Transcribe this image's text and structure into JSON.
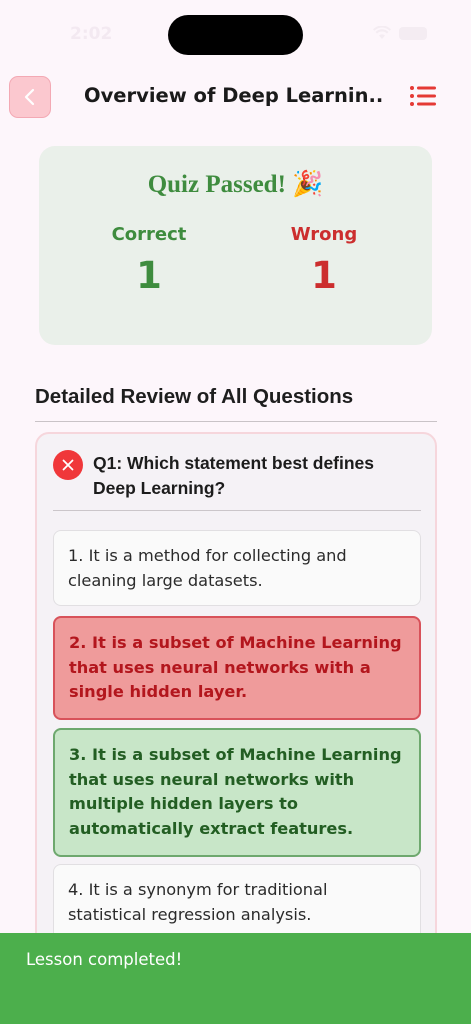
{
  "status_bar": {
    "time": "2:02"
  },
  "header": {
    "title": "Overview of Deep Learnin..."
  },
  "result": {
    "title": "Quiz Passed! 🎉",
    "correct_label": "Correct",
    "correct_count": "1",
    "wrong_label": "Wrong",
    "wrong_count": "1"
  },
  "review": {
    "heading": "Detailed Review of All Questions",
    "questions": [
      {
        "text": "Q1: Which statement best defines Deep Learning?",
        "status": "wrong",
        "options": [
          {
            "text": "1. It is a method for collecting and cleaning large datasets.",
            "state": "neutral"
          },
          {
            "text": "2. It is a subset of Machine Learning that uses neural networks with a single hidden layer.",
            "state": "wrong"
          },
          {
            "text": "3. It is a subset of Machine Learning that uses neural networks with multiple hidden layers to automatically extract features.",
            "state": "correct"
          },
          {
            "text": "4. It is a synonym for traditional statistical regression analysis.",
            "state": "neutral"
          }
        ]
      }
    ]
  },
  "snackbar": {
    "message": "Lesson completed!"
  },
  "colors": {
    "correct": "#3e8c3e",
    "wrong": "#cc2e2e",
    "snackbar": "#4caf4c",
    "accent": "#e53935"
  }
}
